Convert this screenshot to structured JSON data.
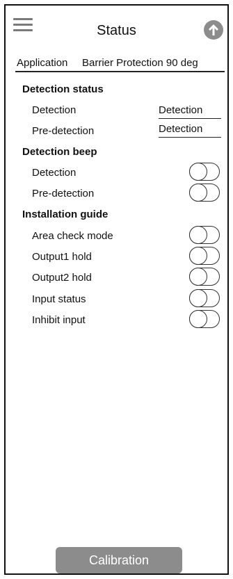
{
  "header": {
    "menu_icon": "hamburger-menu-icon",
    "title": "Status",
    "upload_icon": "upload-arrow-icon"
  },
  "application": {
    "label": "Application",
    "value": "Barrier Protection 90 deg"
  },
  "detection_status": {
    "heading": "Detection status",
    "items": [
      {
        "label": "Detection",
        "value": "Detection"
      },
      {
        "label": "Pre-detection",
        "value": "Detection"
      }
    ]
  },
  "detection_beep": {
    "heading": "Detection beep",
    "items": [
      {
        "label": "Detection",
        "on": false
      },
      {
        "label": "Pre-detection",
        "on": false
      }
    ]
  },
  "installation_guide": {
    "heading": "Installation guide",
    "items": [
      {
        "label": "Area check mode",
        "on": false
      },
      {
        "label": "Output1 hold",
        "on": false
      },
      {
        "label": "Output2 hold",
        "on": false
      },
      {
        "label": "Input status",
        "on": false
      },
      {
        "label": "Inhibit input",
        "on": false
      }
    ]
  },
  "footer": {
    "calibration_label": "Calibration"
  },
  "colors": {
    "button_gray": "#8c8c8c",
    "menu_gray": "#7a7a7a",
    "line": "#222222"
  }
}
